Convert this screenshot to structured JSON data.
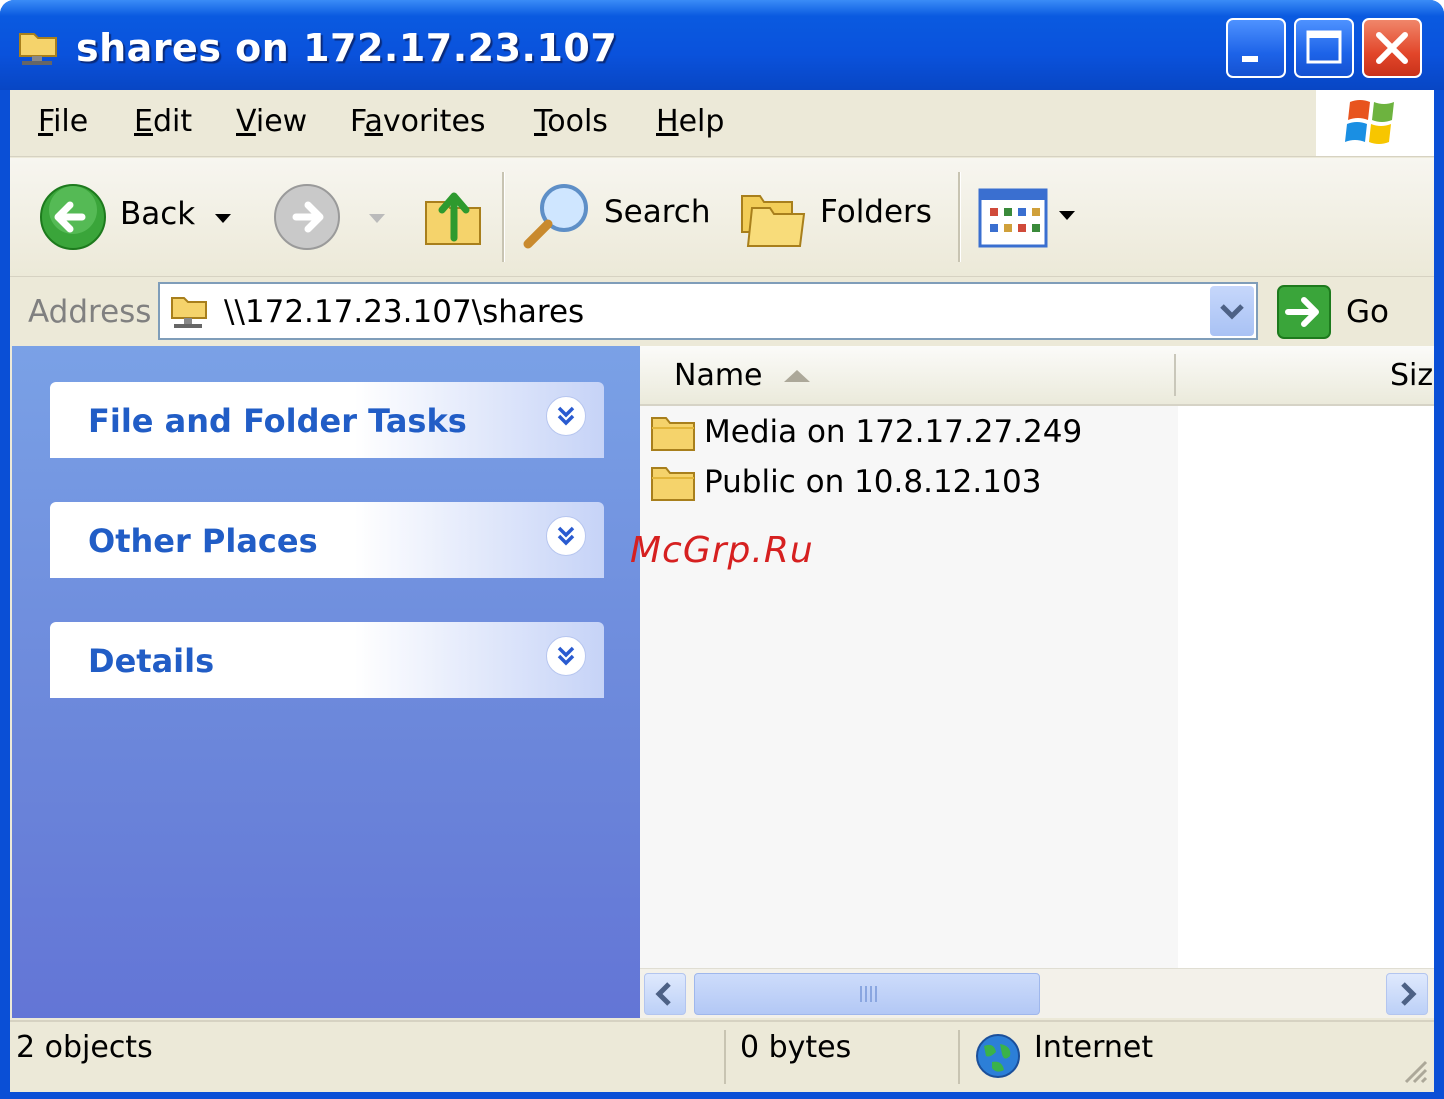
{
  "window": {
    "title": "shares on 172.17.23.107"
  },
  "menu": {
    "items": [
      {
        "label": "File",
        "accel": "F",
        "rest": "ile"
      },
      {
        "label": "Edit",
        "accel": "E",
        "rest": "dit"
      },
      {
        "label": "View",
        "accel": "V",
        "rest": "iew"
      },
      {
        "label": "Favorites",
        "pre": "F",
        "accel": "a",
        "rest": "vorites"
      },
      {
        "label": "Tools",
        "accel": "T",
        "rest": "ools"
      },
      {
        "label": "Help",
        "accel": "H",
        "rest": "elp"
      }
    ]
  },
  "toolbar": {
    "back_label": "Back",
    "search_label": "Search",
    "folders_label": "Folders"
  },
  "address": {
    "label": "Address",
    "value": "\\\\172.17.23.107\\shares",
    "go_label": "Go"
  },
  "taskpane": {
    "sections": [
      {
        "title": "File and Folder Tasks"
      },
      {
        "title": "Other Places"
      },
      {
        "title": "Details"
      }
    ]
  },
  "filelist": {
    "columns": {
      "name": "Name",
      "size": "Siz"
    },
    "items": [
      {
        "name": "Media on 172.17.27.249",
        "icon": "folder-icon"
      },
      {
        "name": "Public on 10.8.12.103",
        "icon": "folder-icon"
      }
    ]
  },
  "watermark": "McGrp.Ru",
  "status": {
    "objects": "2 objects",
    "size": "0 bytes",
    "zone": "Internet"
  },
  "colors": {
    "titlebar": "#0a52dc",
    "taskpane_top": "#7aa1e6",
    "taskpane_bottom": "#6375d6",
    "task_title": "#215dc6",
    "close_button": "#e2462a"
  }
}
